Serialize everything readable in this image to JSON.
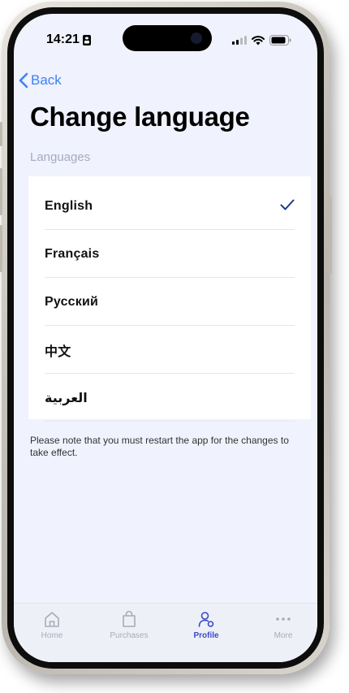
{
  "status_bar": {
    "time": "14:21"
  },
  "nav": {
    "back_label": "Back",
    "title": "Change language"
  },
  "languages": {
    "section_label": "Languages",
    "items": [
      {
        "label": "English",
        "selected": true
      },
      {
        "label": "Français",
        "selected": false
      },
      {
        "label": "Русский",
        "selected": false
      },
      {
        "label": "中文",
        "selected": false
      },
      {
        "label": "العربية",
        "selected": false
      }
    ]
  },
  "note": "Please note that you must restart the app for the changes to take effect.",
  "tabbar": {
    "items": [
      {
        "label": "Home",
        "icon": "home-icon",
        "active": false
      },
      {
        "label": "Purchases",
        "icon": "bag-icon",
        "active": false
      },
      {
        "label": "Profile",
        "icon": "profile-icon",
        "active": true
      },
      {
        "label": "More",
        "icon": "more-icon",
        "active": false
      }
    ]
  },
  "colors": {
    "accent": "#3b82f6",
    "active_tab": "#3b49c8",
    "background": "#f0f2fe",
    "check": "#1e3a8a"
  }
}
